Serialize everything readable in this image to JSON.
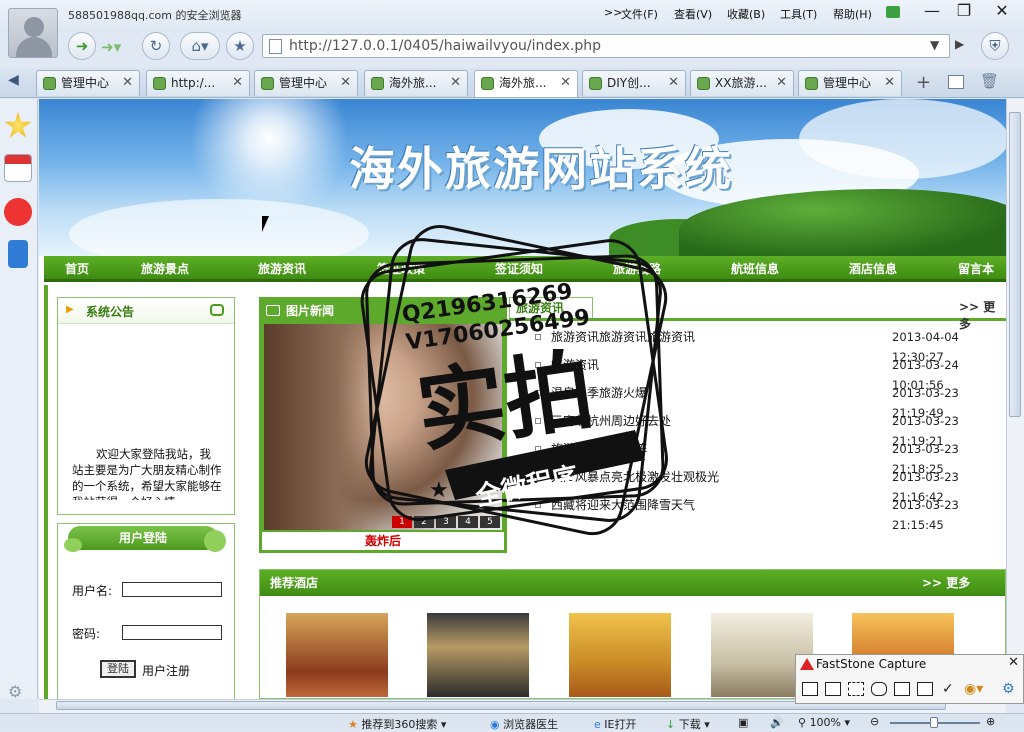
{
  "browser": {
    "account": "588501988qq.com 的安全浏览器",
    "menu": [
      "文件(F)",
      "查看(V)",
      "收藏(B)",
      "工具(T)",
      "帮助(H)"
    ],
    "menu_chevron": ">>",
    "url": "http://127.0.0.1/0405/haiwailvyou/index.php",
    "tabs": [
      "管理中心",
      "http:/...",
      "管理中心",
      "海外旅...",
      "海外旅...",
      "DIY创...",
      "XX旅游...",
      "管理中心"
    ],
    "active_tab_index": 4
  },
  "site": {
    "banner_title": "海外旅游网站系统",
    "nav": [
      "首页",
      "旅游景点",
      "旅游资讯",
      "签证政策",
      "签证须知",
      "旅游线路",
      "航班信息",
      "酒店信息",
      "留言本"
    ],
    "notice": {
      "title": "系统公告",
      "text": "欢迎大家登陆我站，我站主要是为广大朋友精心制作的一个系统，希望大家能够在我站获得一个好心情，"
    },
    "login": {
      "title": "用户登陆",
      "username_label": "用户名:",
      "password_label": "密码:",
      "login_button": "登陆",
      "register_link": "用户注册"
    },
    "picture_news": {
      "title": "图片新闻",
      "caption": "轰炸后",
      "pager": [
        "1",
        "2",
        "3",
        "4",
        "5"
      ]
    },
    "news": {
      "title": "旅游资讯",
      "more": ">> 更多",
      "items": [
        {
          "title": "旅游资讯旅游资讯旅游资讯",
          "date": "2013-04-04 12:30:27"
        },
        {
          "title": "旅游资讯",
          "date": "2013-03-24 10:01:56"
        },
        {
          "title": "温泉冬季旅游火爆",
          "date": "2013-03-23 21:19:49"
        },
        {
          "title": "元宵节杭州周边好去处",
          "date": "2013-03-23 21:19:21"
        },
        {
          "title": "旅游观光列巨石阵",
          "date": "2013-03-23 21:18:25"
        },
        {
          "title": "太阳风暴点亮北极激发壮观极光",
          "date": "2013-03-23 21:16:42"
        },
        {
          "title": "西藏将迎来大范围降雪天气",
          "date": "2013-03-23 21:15:45"
        }
      ]
    },
    "hotels": {
      "title": "推荐酒店",
      "more": ">> 更多"
    }
  },
  "watermark": {
    "line1": "Q2196316269",
    "line2": "V17060256499",
    "big": "实拍",
    "ribbon": "全微程序"
  },
  "statusbar": {
    "items": [
      "推荐到360搜索",
      "浏览器医生",
      "IE打开",
      "下载",
      "100%"
    ]
  },
  "faststone": {
    "title": "FastStone Capture"
  },
  "colors": {
    "site_green": "#4c9a1e",
    "accent_red": "#cc0000"
  }
}
